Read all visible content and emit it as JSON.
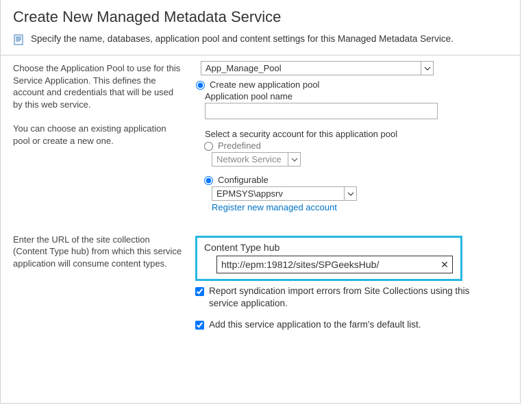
{
  "title": "Create New Managed Metadata Service",
  "intro": "Specify the name, databases, application pool and content settings for this Managed Metadata Service.",
  "left": {
    "app_pool_desc1": "Choose the Application Pool to use for this Service Application.  This defines the account and credentials that will be used by this web service.",
    "app_pool_desc2": "You can choose an existing application pool or create a new one.",
    "hub_desc": "Enter the URL of the site collection (Content Type hub) from which this service application will consume content types."
  },
  "right": {
    "existing_pool_select": "App_Manage_Pool",
    "create_pool_label": "Create new application pool",
    "pool_name_label": "Application pool name",
    "pool_name_value": "",
    "security_label": "Select a security account for this application pool",
    "predefined_label": "Predefined",
    "predefined_select": "Network Service",
    "configurable_label": "Configurable",
    "configurable_select": "EPMSYS\\appsrv",
    "register_link": "Register new managed account",
    "hub_label": "Content Type hub",
    "hub_value": "http://epm:19812/sites/SPGeeksHub/",
    "report_errors_label": "Report syndication import errors from Site Collections using this service application.",
    "add_default_label": "Add this service application to the farm's default list."
  }
}
